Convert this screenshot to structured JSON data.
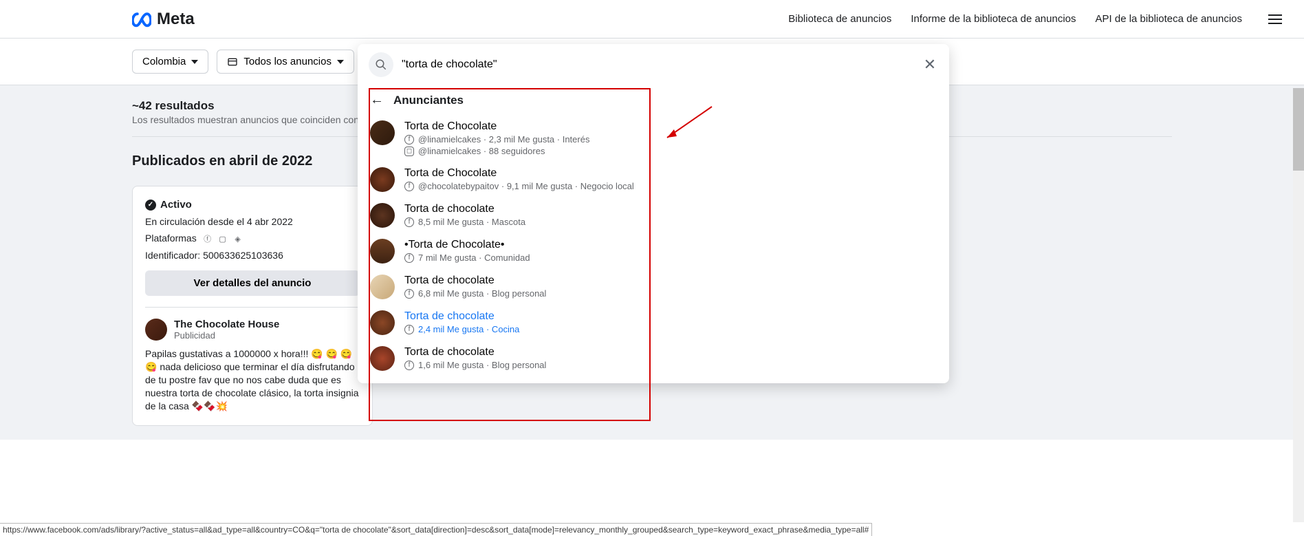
{
  "header": {
    "brand": "Meta",
    "nav": {
      "library": "Biblioteca de anuncios",
      "report": "Informe de la biblioteca de anuncios",
      "api": "API de la biblioteca de anuncios"
    }
  },
  "filters": {
    "country": "Colombia",
    "adtype": "Todos los anuncios"
  },
  "results": {
    "count": "~42 resultados",
    "desc": "Los resultados muestran anuncios que coinciden con el tér",
    "section": "Publicados en abril de 2022"
  },
  "card": {
    "status": "Activo",
    "circ": "En circulación desde el 4 abr 2022",
    "platforms_label": "Plataformas",
    "id_label": "Identificador:",
    "id_value": "500633625103636",
    "details_btn": "Ver detalles del anuncio",
    "page_name": "The Chocolate House",
    "sponsored": "Publicidad",
    "body": "Papilas gustativas a 1000000 x hora!!! 😋 😋 😋 😋 nada delicioso que terminar el día disfrutando de tu postre fav que no nos cabe duda que es nuestra torta de chocolate clásico, la torta insignia de la casa 🍫🍫💥"
  },
  "search": {
    "query": "\"torta de chocolate\"",
    "section_title": "Anunciantes",
    "items": [
      {
        "name": "Torta de Chocolate",
        "meta_lines": [
          {
            "net": "fb",
            "text": "@linamielcakes · 2,3 mil Me gusta · Interés"
          },
          {
            "net": "ig",
            "text": "@linamielcakes · 88 seguidores"
          }
        ],
        "avatar_bg": "linear-gradient(135deg,#4a2c17,#2d1a0d)"
      },
      {
        "name": "Torta de Chocolate",
        "meta_lines": [
          {
            "net": "fb",
            "text": "@chocolatebypaitov · 9,1 mil Me gusta · Negocio local"
          }
        ],
        "avatar_bg": "radial-gradient(circle,#7b3b1f,#3a1a0c)"
      },
      {
        "name": "Torta de chocolate",
        "meta_lines": [
          {
            "net": "fb",
            "text": "8,5 mil Me gusta · Mascota"
          }
        ],
        "avatar_bg": "radial-gradient(circle,#5c3420,#2a150a)"
      },
      {
        "name": "•Torta de Chocolate•",
        "meta_lines": [
          {
            "net": "fb",
            "text": "7 mil Me gusta · Comunidad"
          }
        ],
        "avatar_bg": "linear-gradient(180deg,#6b3e21,#3d2212)"
      },
      {
        "name": "Torta de chocolate",
        "meta_lines": [
          {
            "net": "fb",
            "text": "6,8 mil Me gusta · Blog personal"
          }
        ],
        "avatar_bg": "linear-gradient(135deg,#e8d5b5,#c8a878)"
      },
      {
        "name": "Torta de chocolate",
        "link": true,
        "meta_lines": [
          {
            "net": "fb",
            "text": "2,4 mil Me gusta · Cocina",
            "link": true
          }
        ],
        "avatar_bg": "radial-gradient(circle,#8b4726,#4a2512)"
      },
      {
        "name": "Torta de chocolate",
        "meta_lines": [
          {
            "net": "fb",
            "text": "1,6 mil Me gusta · Blog personal"
          }
        ],
        "avatar_bg": "radial-gradient(circle,#a8452a,#5c2415)"
      }
    ]
  },
  "status_url": "https://www.facebook.com/ads/library/?active_status=all&ad_type=all&country=CO&q=\"torta de chocolate\"&sort_data[direction]=desc&sort_data[mode]=relevancy_monthly_grouped&search_type=keyword_exact_phrase&media_type=all#"
}
